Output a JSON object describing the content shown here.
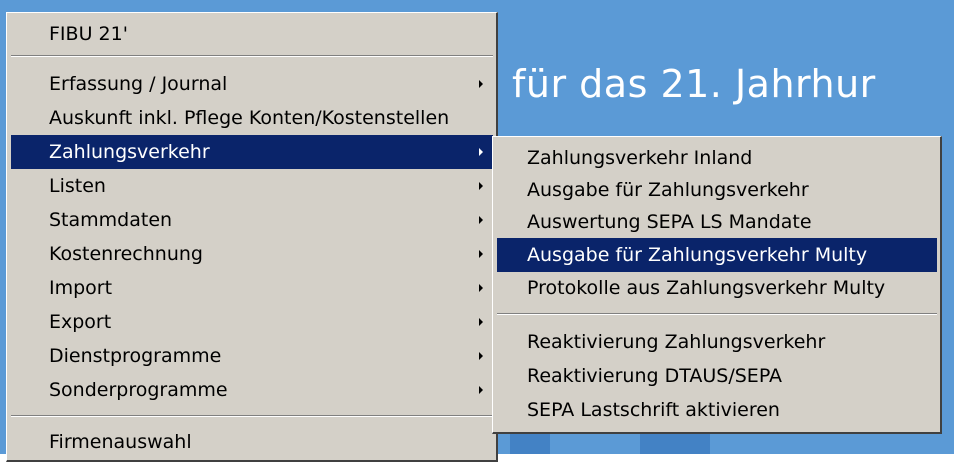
{
  "background": {
    "title_fragment": "für das 21. Jahrhur",
    "color": "#5b9ad6"
  },
  "main_menu": {
    "header": "FIBU 21'",
    "items": [
      {
        "label": "Erfassung / Journal",
        "has_submenu": true
      },
      {
        "label": "Auskunft inkl. Pflege Konten/Kostenstellen",
        "has_submenu": false
      },
      {
        "label": "Zahlungsverkehr",
        "has_submenu": true,
        "highlighted": true
      },
      {
        "label": "Listen",
        "has_submenu": true
      },
      {
        "label": "Stammdaten",
        "has_submenu": true
      },
      {
        "label": "Kostenrechnung",
        "has_submenu": true
      },
      {
        "label": "Import",
        "has_submenu": true
      },
      {
        "label": "Export",
        "has_submenu": true
      },
      {
        "label": "Dienstprogramme",
        "has_submenu": true
      },
      {
        "label": "Sonderprogramme",
        "has_submenu": true
      }
    ],
    "footer": "Firmenauswahl"
  },
  "submenu": {
    "items": [
      {
        "label": "Zahlungsverkehr Inland"
      },
      {
        "label": "Ausgabe für Zahlungsverkehr"
      },
      {
        "label": "Auswertung SEPA LS Mandate"
      },
      {
        "label": "Ausgabe für Zahlungsverkehr Multy",
        "highlighted": true
      },
      {
        "label": "Protokolle aus Zahlungsverkehr Multy"
      }
    ],
    "items_after_separator": [
      {
        "label": "Reaktivierung Zahlungsverkehr"
      },
      {
        "label": "Reaktivierung DTAUS/SEPA"
      },
      {
        "label": "SEPA Lastschrift aktivieren"
      }
    ]
  },
  "colors": {
    "menu_bg": "#d4d0c8",
    "highlight": "#0a246a",
    "highlight_text": "#ffffff"
  }
}
